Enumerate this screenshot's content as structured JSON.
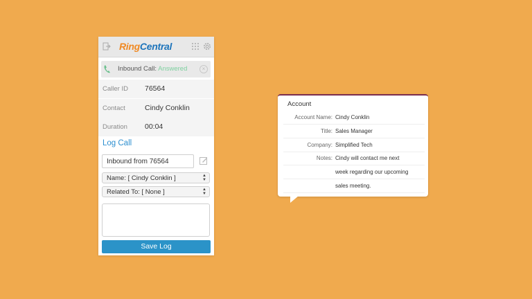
{
  "widget": {
    "brand": {
      "part1": "Ring",
      "part2": "Central"
    },
    "call_status": {
      "prefix": "Inbound Call: ",
      "state": "Answered"
    },
    "info": [
      {
        "label": "Caller ID",
        "value": "76564"
      },
      {
        "label": "Contact",
        "value": "Cindy Conklin"
      },
      {
        "label": "Duration",
        "value": "00:04"
      }
    ],
    "log_title": "Log Call",
    "subject_value": "Inbound from 76564",
    "name_select": "Name: [ Cindy Conklin ]",
    "related_select": "Related To: [ None ]",
    "notes_value": "",
    "save_label": "Save Log"
  },
  "account": {
    "title": "Account",
    "fields": [
      {
        "label": "Account Name:",
        "value": "Cindy Conklin"
      },
      {
        "label": "Title:",
        "value": "Sales Manager"
      },
      {
        "label": "Company:",
        "value": "Simplified Tech"
      },
      {
        "label": "Notes:",
        "value": "Cindy will contact me next"
      },
      {
        "label": "",
        "value": "week regarding our upcoming"
      },
      {
        "label": "",
        "value": "sales meeting."
      }
    ]
  },
  "colors": {
    "background": "#f0aa4e",
    "brand_orange": "#f08a24",
    "brand_blue": "#1d74bb",
    "answered": "#7fd0a0",
    "accent_blue": "#2b93c8",
    "popover_border": "#7a2c4e"
  },
  "icons": [
    "logout-icon",
    "dialpad-icon",
    "gear-icon",
    "phone-icon",
    "close-icon",
    "edit-icon",
    "resize-grip-icon"
  ]
}
